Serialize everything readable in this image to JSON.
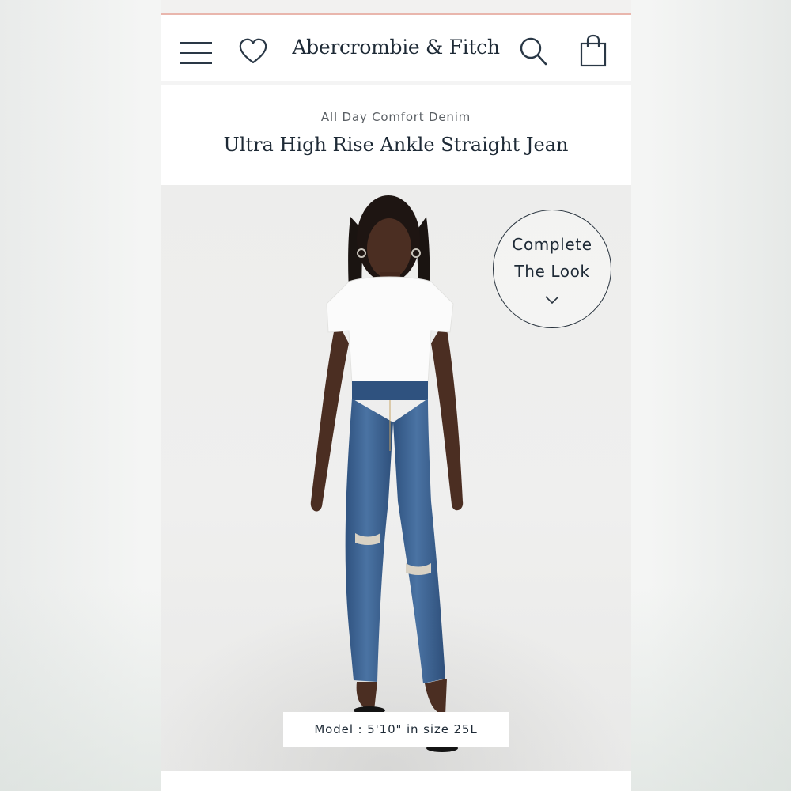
{
  "header": {
    "brand": "Abercrombie & Fitch",
    "menu_icon": "hamburger-menu-icon",
    "wishlist_icon": "heart-icon",
    "search_icon": "search-icon",
    "bag_icon": "shopping-bag-icon"
  },
  "product": {
    "collection": "All Day Comfort Denim",
    "title": "Ultra High Rise Ankle Straight Jean",
    "complete_look_line1": "Complete",
    "complete_look_line2": "The Look",
    "model_info": "Model : 5'10\" in size 25L"
  },
  "colors": {
    "text_primary": "#1e2a36",
    "accent_line": "#e9b6ad",
    "denim": "#3a5f8e"
  }
}
